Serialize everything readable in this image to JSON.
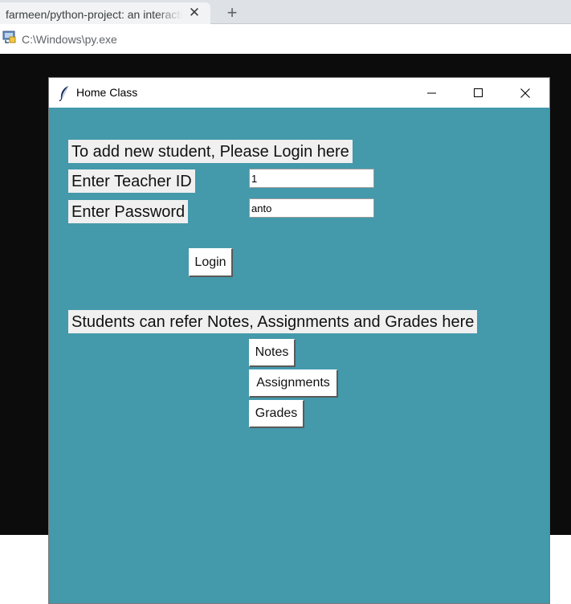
{
  "browser": {
    "tab_title": "farmeen/python-project: an interactive system",
    "close_glyph": "✕",
    "new_tab_glyph": "+"
  },
  "console": {
    "path": "C:\\Windows\\py.exe",
    "icon": "python-console-icon"
  },
  "window": {
    "title": "Home Class",
    "icon": "tk-feather-icon",
    "controls": [
      "minimize-icon",
      "maximize-icon",
      "close-icon"
    ],
    "background": "#4499ab"
  },
  "teacher_section": {
    "heading": "To add new student, Please Login here",
    "id_label": "Enter Teacher ID",
    "id_value": "1",
    "password_label": "Enter Password",
    "password_value": "anto",
    "login_button": "Login"
  },
  "student_section": {
    "heading": "Students can refer Notes, Assignments and Grades here",
    "buttons": [
      "Notes",
      "Assignments",
      "Grades"
    ]
  }
}
